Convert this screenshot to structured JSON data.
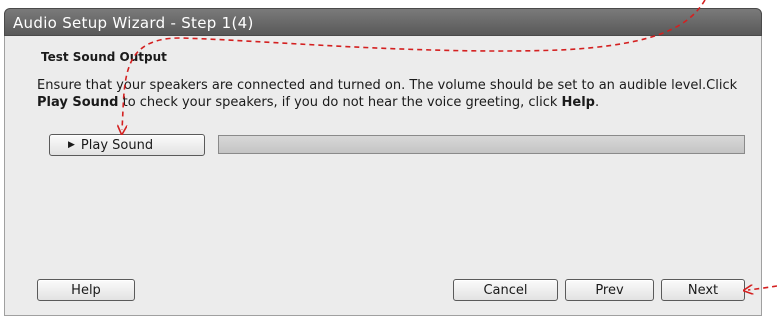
{
  "window": {
    "title": "Audio Setup Wizard - Step 1(4)"
  },
  "content": {
    "heading": "Test Sound Output",
    "desc_part1": "Ensure that your speakers are connected and turned on. The volume should be set to an audible level.Click ",
    "desc_bold1": "Play Sound",
    "desc_part2": " to check your speakers, if you do not hear the voice greeting, click ",
    "desc_bold2": "Help",
    "desc_part3": "."
  },
  "play_button": {
    "icon": "play-icon",
    "label": "Play Sound"
  },
  "progress": {
    "value": 0
  },
  "footer": {
    "help_label": "Help",
    "cancel_label": "Cancel",
    "prev_label": "Prev",
    "next_label": "Next"
  },
  "colors": {
    "annotation": "#d42020",
    "titlebar": "#6a6a6a",
    "panel": "#ececec"
  }
}
